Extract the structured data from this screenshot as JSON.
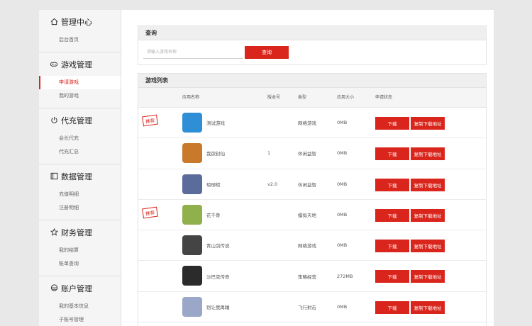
{
  "sidebar": {
    "groups": [
      {
        "title": "管理中心",
        "icon": "home-icon",
        "items": [
          {
            "label": "后台首页",
            "active": false
          }
        ]
      },
      {
        "title": "游戏管理",
        "icon": "gamepad-icon",
        "items": [
          {
            "label": "申请游戏",
            "active": true
          },
          {
            "label": "我的游戏",
            "active": false
          }
        ]
      },
      {
        "title": "代充管理",
        "icon": "power-icon",
        "items": [
          {
            "label": "会长代充",
            "active": false
          },
          {
            "label": "代充汇总",
            "active": false
          }
        ]
      },
      {
        "title": "数据管理",
        "icon": "data-icon",
        "items": [
          {
            "label": "充值明细",
            "active": false
          },
          {
            "label": "注册明细",
            "active": false
          }
        ]
      },
      {
        "title": "财务管理",
        "icon": "star-icon",
        "items": [
          {
            "label": "我的结算",
            "active": false
          },
          {
            "label": "账单查询",
            "active": false
          }
        ]
      },
      {
        "title": "账户管理",
        "icon": "account-icon",
        "items": [
          {
            "label": "我的基本信息",
            "active": false
          },
          {
            "label": "子账号管理",
            "active": false
          }
        ]
      }
    ]
  },
  "query": {
    "title": "查询",
    "placeholder": "请输入游戏名称",
    "button": "查询"
  },
  "list": {
    "title": "游戏列表",
    "columns": [
      "应用名称",
      "版本号",
      "类型",
      "应用大小",
      "申请状态"
    ],
    "download_label": "下载",
    "copy_label": "复制下载地址",
    "rows": [
      {
        "name": "测试游戏",
        "version": "",
        "type": "网络游戏",
        "size": "0MB",
        "recommended": true,
        "badge": "推荐",
        "icon": "app-icon-test",
        "color": "#2e8fd6"
      },
      {
        "name": "我欲封仙",
        "version": "1",
        "type": "休闲益智",
        "size": "0MB",
        "recommended": false,
        "badge": "",
        "icon": "app-icon-wyfx",
        "color": "#c87a2a"
      },
      {
        "name": "琅琊榜",
        "version": "v2.0",
        "type": "休闲益智",
        "size": "0MB",
        "recommended": false,
        "badge": "",
        "icon": "app-icon-lyb",
        "color": "#5b6b9a"
      },
      {
        "name": "花千骨",
        "version": "",
        "type": "模拟天地",
        "size": "0MB",
        "recommended": true,
        "badge": "推荐",
        "icon": "app-icon-hqg",
        "color": "#8fb04a"
      },
      {
        "name": "青山剑传说",
        "version": "",
        "type": "网络游戏",
        "size": "0MB",
        "recommended": false,
        "badge": "",
        "icon": "app-icon-qs",
        "color": "#444444"
      },
      {
        "name": "沙巴克传奇",
        "version": "",
        "type": "策略经营",
        "size": "272MB",
        "recommended": false,
        "badge": "",
        "icon": "app-icon-sbk",
        "color": "#2b2b2b"
      },
      {
        "name": "别让我再睡",
        "version": "",
        "type": "飞行射击",
        "size": "0MB",
        "recommended": false,
        "badge": "",
        "icon": "app-icon-brw",
        "color": "#9aa7c9"
      }
    ]
  }
}
